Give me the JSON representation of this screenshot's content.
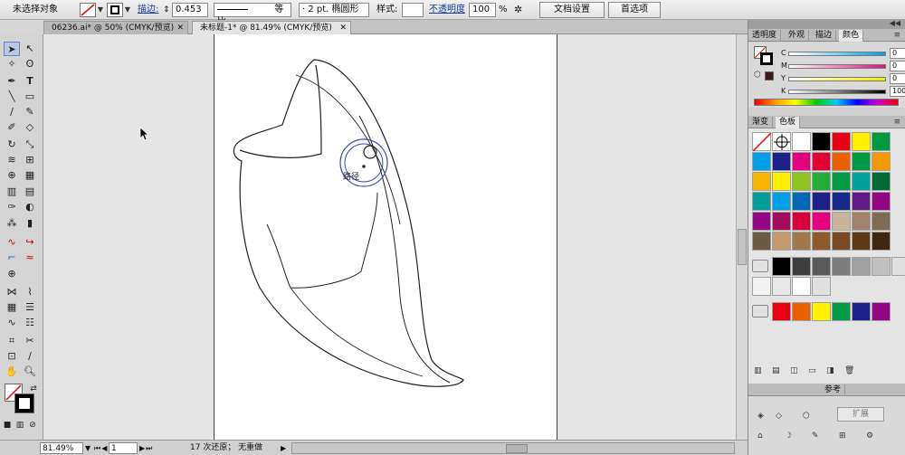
{
  "control_bar": {
    "selection_status": "未选择对象",
    "stroke_label": "描边:",
    "stroke_weight": "0.453",
    "profile_label": "等比",
    "brush_label": "2 pt. 椭圆形",
    "style_label": "样式:",
    "opacity_label": "不透明度",
    "opacity_value": "100",
    "opacity_unit": "%",
    "doc_setup_button": "文档设置",
    "preferences_button": "首选项"
  },
  "tabs": [
    {
      "label": "06236.ai* @ 50% (CMYK/预览)",
      "close": "✕"
    },
    {
      "label": "未标题-1* @ 81.49% (CMYK/预览)",
      "close": "✕"
    }
  ],
  "canvas": {
    "path_tooltip": "路径"
  },
  "status_bar": {
    "zoom": "81.49%",
    "page": "1",
    "history": "17 次还原； 无重做"
  },
  "color_panel": {
    "tabs": [
      "透明度",
      "外观",
      "描边",
      "颜色"
    ],
    "channels": [
      {
        "label": "C",
        "value": "0",
        "gradient": "linear-gradient(90deg,#fff,#00a0e0)"
      },
      {
        "label": "M",
        "value": "0",
        "gradient": "linear-gradient(90deg,#fff,#e0107a)"
      },
      {
        "label": "Y",
        "value": "0",
        "gradient": "linear-gradient(90deg,#fff,#f5e800)"
      },
      {
        "label": "K",
        "value": "100",
        "gradient": "linear-gradient(90deg,#fff,#000)"
      }
    ]
  },
  "swatches_panel": {
    "tabs": [
      "渐变",
      "色板"
    ],
    "rows": [
      [
        "none",
        "registration",
        "#ffffff",
        "#000000",
        "#e60012",
        "#fff100",
        "#009944"
      ],
      [
        "#00a0e9",
        "#1d2088",
        "#e4007f",
        "#e60033",
        "#eb6100",
        "#009944",
        "#f39800"
      ],
      [
        "#f8b500",
        "#fff100",
        "#8fc31f",
        "#22ac38",
        "#009944",
        "#00a29a",
        "#006934"
      ],
      [
        "#009e96",
        "#00a0e9",
        "#0068b7",
        "#1d2088",
        "#172a88",
        "#601986",
        "#920783"
      ],
      [
        "#920783",
        "#a40b5d",
        "#d7003a",
        "#e4007f",
        "#c8b498",
        "#a0826d",
        "#7d6b55"
      ],
      [
        "#6d5a45",
        "#c49a6c",
        "#a0784b",
        "#8c5a2b",
        "#7a4a22",
        "#603813",
        "#3d2612"
      ]
    ],
    "gray_row": [
      "#000000",
      "#3e3e3e",
      "#595959",
      "#7d7d7d",
      "#a0a0a0",
      "#c0c0c0",
      "#e0e0e0"
    ],
    "gray_row2": [
      "#f2f2f2",
      "#e8e8e8",
      "#ffffff",
      "#e0e0e0"
    ],
    "color_group": [
      "#e60012",
      "#eb6100",
      "#fff100",
      "#009944",
      "#1d2088",
      "#920783"
    ]
  },
  "symbols_panel": {
    "tab": "参考",
    "expand_button": "扩展"
  },
  "icons": {
    "selection": "selection-arrow-icon",
    "fill_stroke": "fill-stroke-icon"
  }
}
